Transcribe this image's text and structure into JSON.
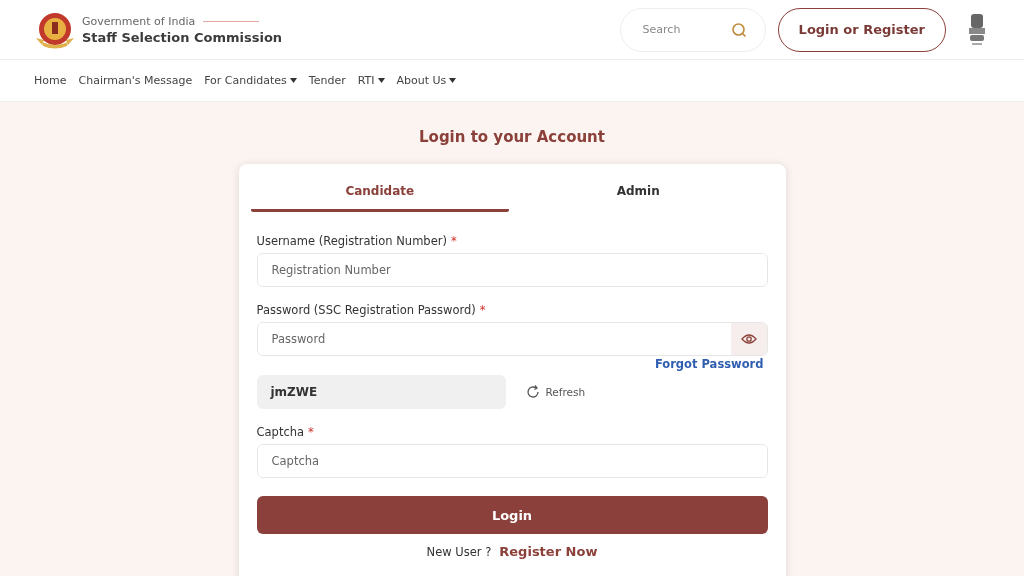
{
  "header": {
    "org_top": "Government of India",
    "org_name": "Staff Selection Commission",
    "search": {
      "placeholder": "Search"
    },
    "login_button": "Login or Register"
  },
  "nav": [
    {
      "label": "Home",
      "dropdown": false
    },
    {
      "label": "Chairman's Message",
      "dropdown": false
    },
    {
      "label": "For Candidates",
      "dropdown": true
    },
    {
      "label": "Tender",
      "dropdown": false
    },
    {
      "label": "RTI",
      "dropdown": true
    },
    {
      "label": "About Us",
      "dropdown": true
    }
  ],
  "title": "Login to your Account",
  "tabs": [
    {
      "label": "Candidate",
      "selected": true
    },
    {
      "label": "Admin",
      "selected": false
    }
  ],
  "fields": [
    {
      "label": "Username (Registration Number)",
      "required_mark": "*",
      "placeholder": "Registration Number",
      "kind": "text"
    },
    {
      "label": "Password (SSC Registration Password)",
      "required_mark": "*",
      "placeholder": "Password",
      "kind": "password"
    }
  ],
  "forgot_link": "Forgot Password",
  "captcha": {
    "code": "jmZWE",
    "refresh": "Refresh",
    "label": "Captcha",
    "required_mark": "*",
    "placeholder": "Captcha"
  },
  "login_button": "Login",
  "register": {
    "prompt": "New User ?",
    "link": "Register Now"
  }
}
